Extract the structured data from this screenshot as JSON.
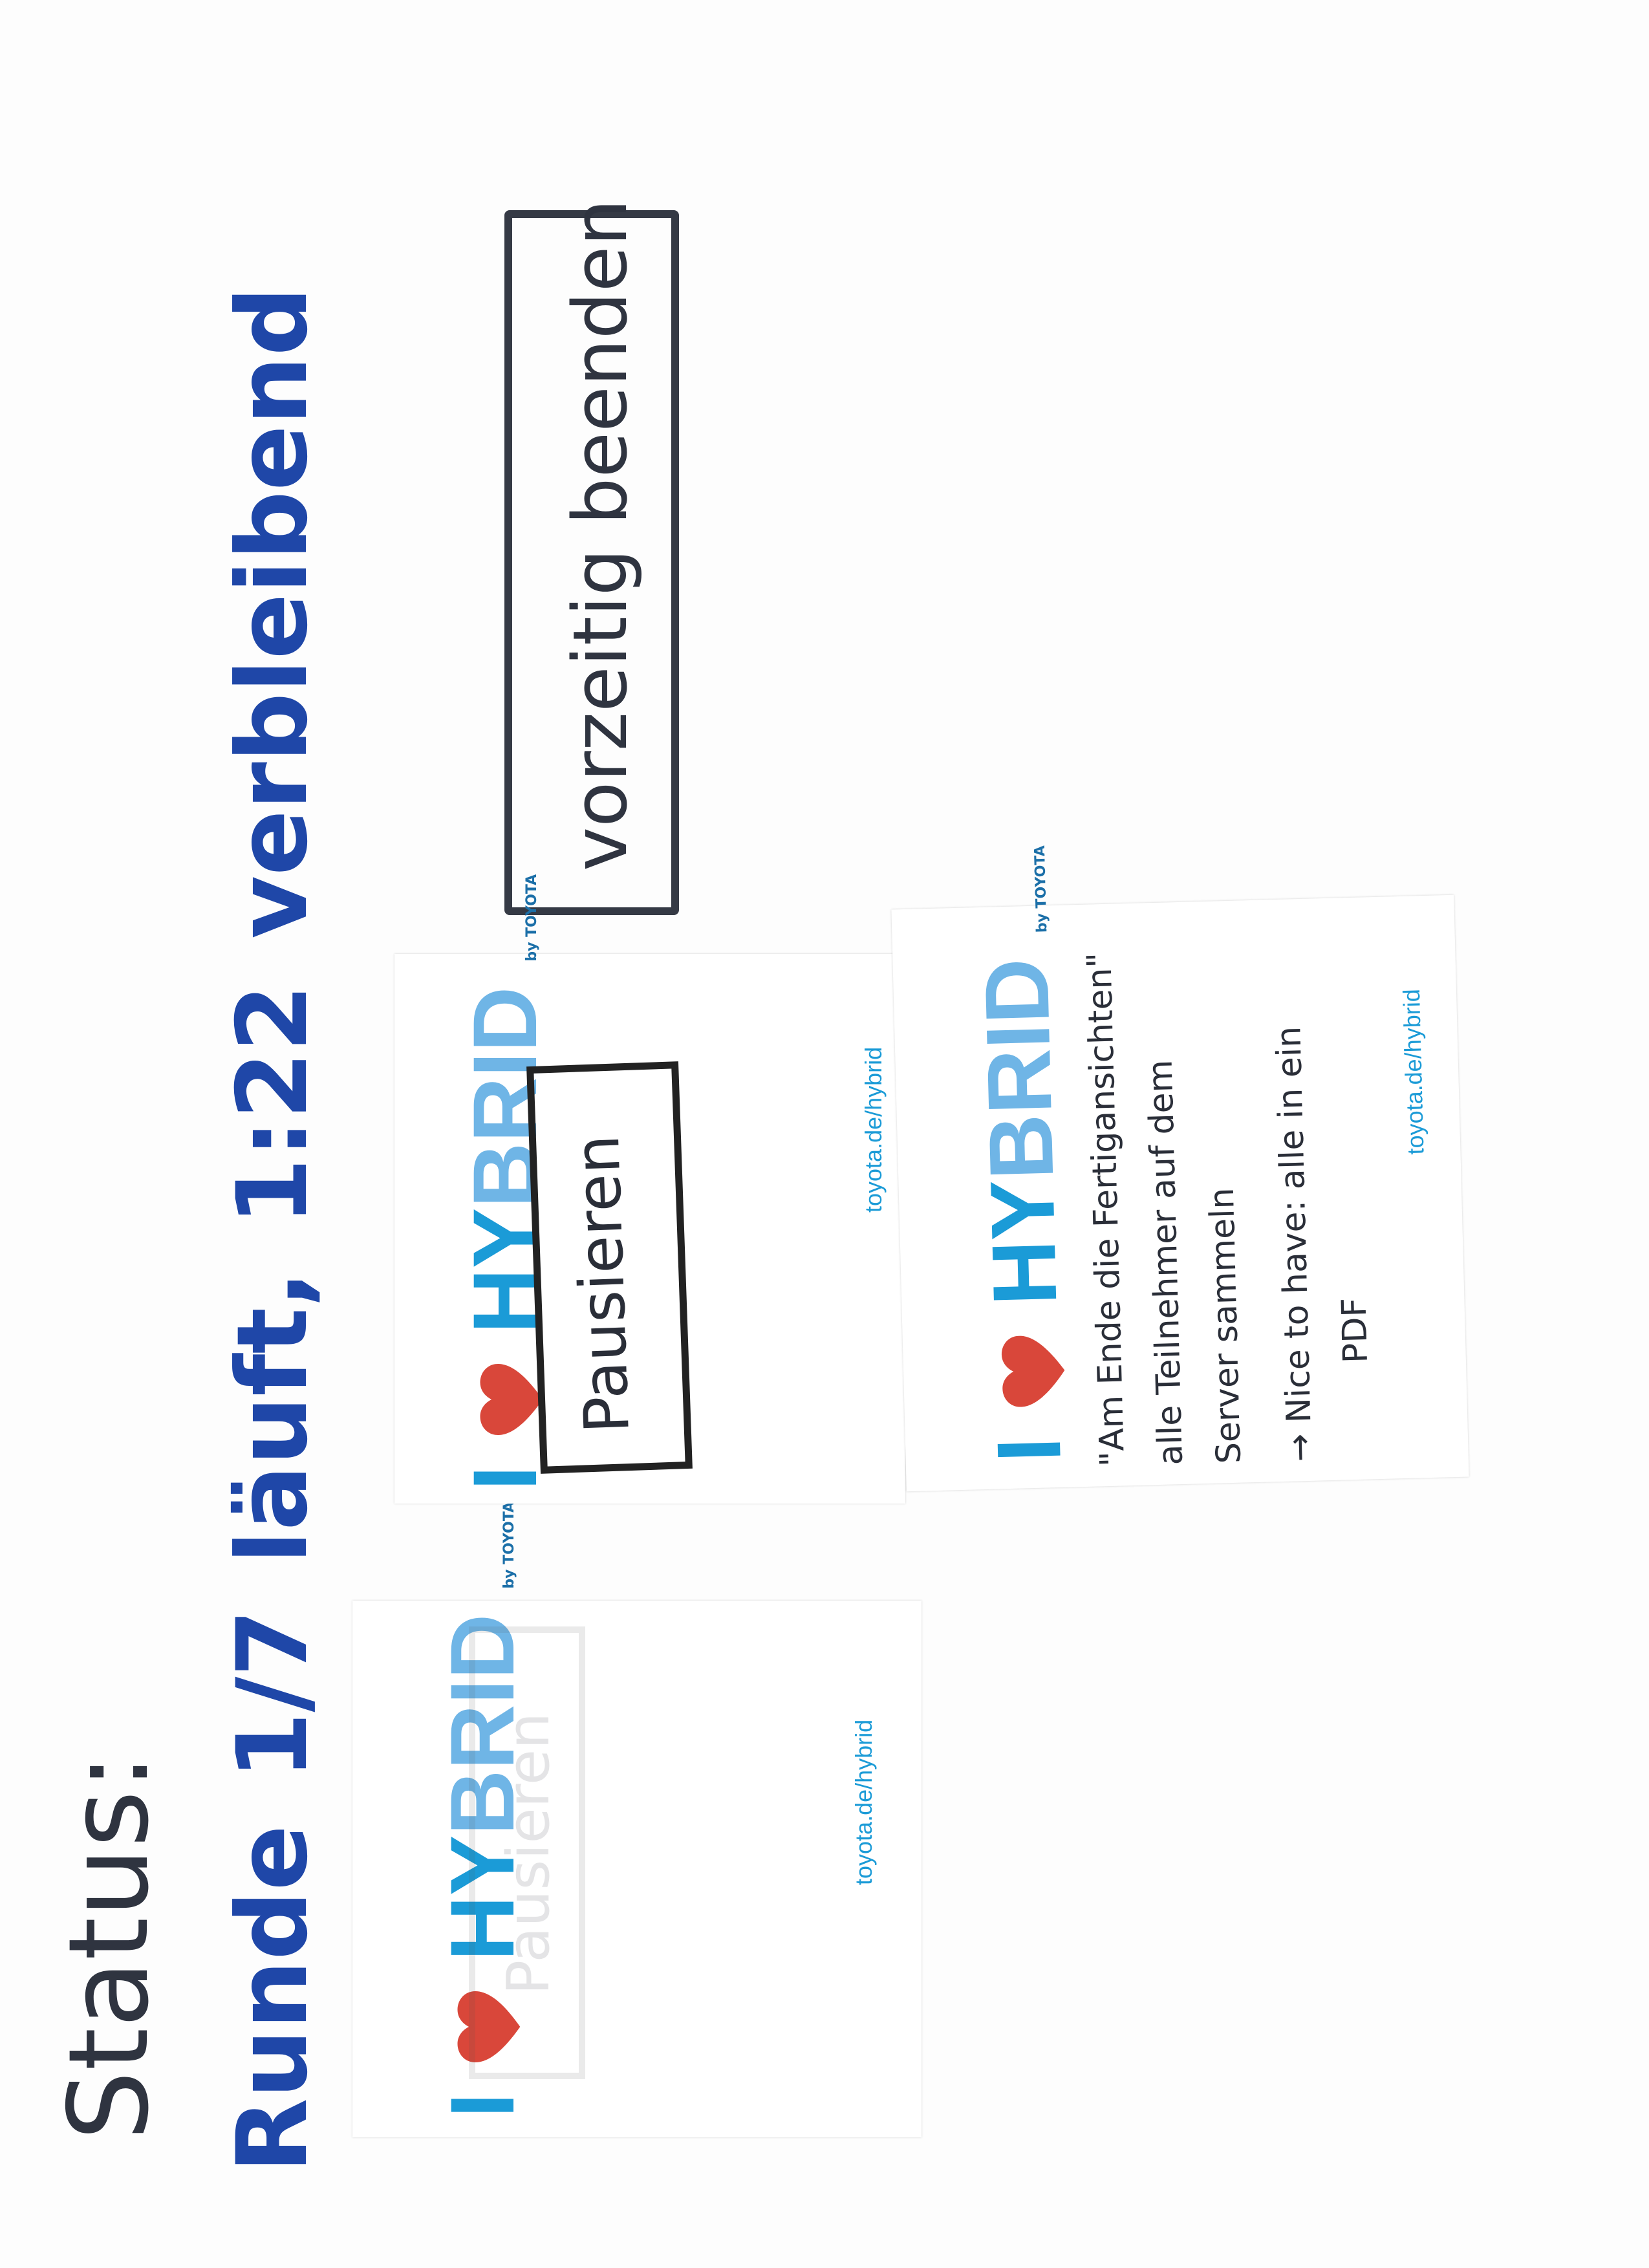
{
  "status": {
    "label": "Status:",
    "round_word": "Runde",
    "round_value": "1/7",
    "state": "läuft,",
    "time_remaining": "1:22",
    "remaining_label": "verbleibend"
  },
  "finish_button": {
    "label": "vorzeitig beenden"
  },
  "notes": [
    {
      "brand_i": "I",
      "brand_hy": "HY",
      "brand_brid": "BRID",
      "brand_by": "by TOYOTA",
      "url": "toyota.de/hybrid",
      "button_label": "Pausieren"
    },
    {
      "brand_i": "I",
      "brand_hy": "HY",
      "brand_brid": "BRID",
      "brand_by": "by TOYOTA",
      "url": "toyota.de/hybrid",
      "button_label": "Pausieren"
    },
    {
      "brand_i": "I",
      "brand_hy": "HY",
      "brand_brid": "BRID",
      "brand_by": "by TOYOTA",
      "url": "toyota.de/hybrid",
      "lines": [
        "\"Am Ende die Fertigansichten\"",
        "alle Teilnehmer auf dem",
        "Server sammeln",
        "→ Nice to have: alle in ein",
        "PDF"
      ]
    }
  ],
  "colors": {
    "ink_dark": "#2f3440",
    "ink_blue": "#1f47a8",
    "brand_blue": "#1b9bd7",
    "heart_red": "#d9473a"
  }
}
